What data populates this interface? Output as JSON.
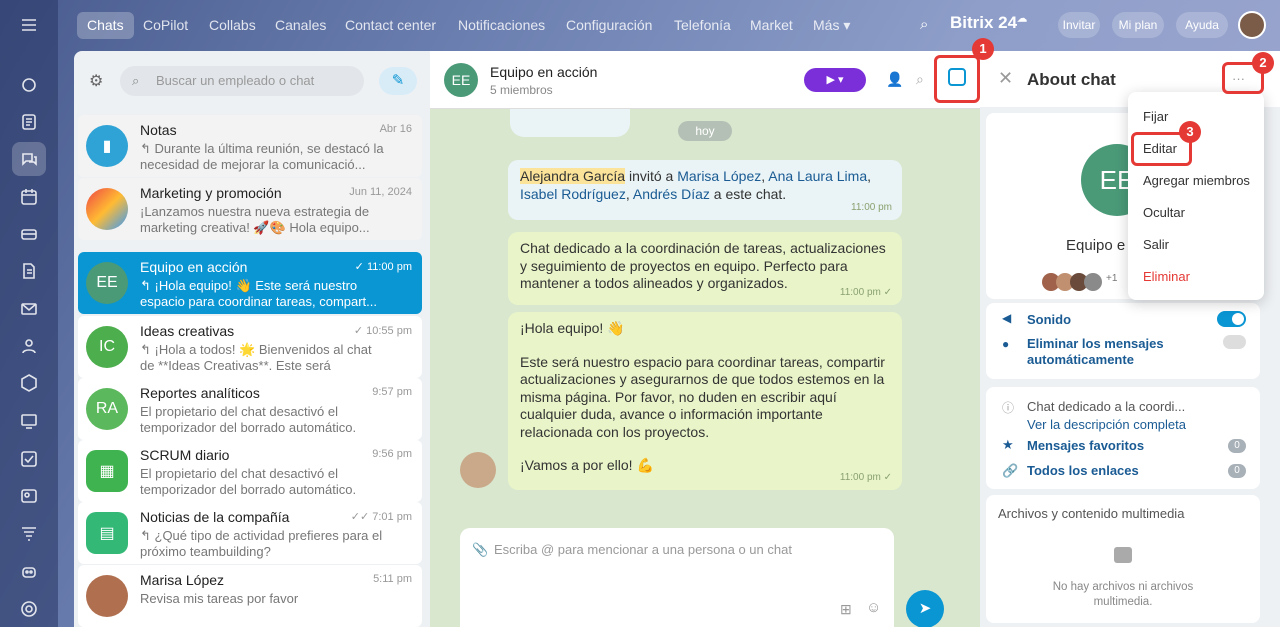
{
  "topbar": {
    "tabs": [
      "Chats",
      "CoPilot",
      "Collabs",
      "Canales",
      "Contact center",
      "Notificaciones",
      "Configuración",
      "Telefonía",
      "Market",
      "Más ▾"
    ],
    "brand": "Bitrix 24",
    "brand_sup": "☁",
    "invite": "Invitar",
    "plan": "Mi plan",
    "help": "Ayuda"
  },
  "left": {
    "search_placeholder": "Buscar un empleado o chat",
    "chats": [
      {
        "name": "Notas",
        "time": "Abr 16",
        "preview": "↰ Durante la última reunión, se destacó la necesidad de mejorar la comunicació...",
        "initials": "",
        "color": "#2fa3d6"
      },
      {
        "name": "Marketing y promoción",
        "time": "Jun 11, 2024",
        "preview": "¡Lanzamos nuestra nueva estrategia de marketing creativa! 🚀🎨 Hola equipo...",
        "initials": "",
        "color": "#e36"
      },
      {
        "name": "Equipo en acción",
        "time": "✓ 11:00 pm",
        "preview": "↰ ¡Hola equipo! 👋 Este será nuestro espacio para coordinar tareas, compart...",
        "initials": "EE",
        "color": "#4a9a78"
      },
      {
        "name": "Ideas creativas",
        "time": "✓ 10:55 pm",
        "preview": "↰ ¡Hola a todos! 🌟 Bienvenidos al chat de **Ideas Creativas**. Este será nuestro...",
        "initials": "IC",
        "color": "#4cae4c"
      },
      {
        "name": "Reportes analíticos",
        "time": "9:57 pm",
        "preview": "El propietario del chat desactivó el temporizador del borrado automático.",
        "initials": "RA",
        "color": "#5cb85c"
      },
      {
        "name": "SCRUM diario",
        "time": "9:56 pm",
        "preview": "El propietario del chat desactivó el temporizador del borrado automático.",
        "initials": "",
        "color": "#3fb34f"
      },
      {
        "name": "Noticias de la compañía",
        "time": "✓✓ 7:01 pm",
        "preview": "↰ ¿Qué tipo de actividad prefieres para el próximo teambuilding?",
        "initials": "",
        "color": "#33b876"
      },
      {
        "name": "Marisa López",
        "time": "5:11 pm",
        "preview": "Revisa mis tareas por favor",
        "initials": "",
        "color": "#b07050"
      }
    ]
  },
  "center": {
    "title": "Equipo en acción",
    "subtitle": "5 miembros",
    "initials": "EE",
    "day": "hoy",
    "sys_name": "Alejandra García",
    "sys_verb": " invitó a ",
    "sys_people": [
      "Marisa López",
      "Ana Laura Lima",
      "Isabel Rodríguez",
      "Andrés Díaz"
    ],
    "sys_tail": " a este chat.",
    "sys_time": "11:00 pm",
    "msg1": "Chat dedicado a la coordinación de tareas, actualizaciones y seguimiento de proyectos en equipo. Perfecto para mantener a todos alineados y organizados.",
    "msg1_time": "11:00 pm ✓",
    "msg2_a": "¡Hola equipo! 👋",
    "msg2_b": "Este será nuestro espacio para coordinar tareas, compartir actualizaciones y asegurarnos de que todos estemos en la misma página. Por favor, no duden en escribir aquí cualquier duda, avance o información importante relacionada con los proyectos.",
    "msg2_c": "¡Vamos a por ello! 💪",
    "msg2_time": "11:00 pm ✓",
    "input_placeholder": "Escriba @ para mencionar a una persona o un chat"
  },
  "right": {
    "title": "About chat",
    "chat_name": "Equipo e",
    "avatar": "EE",
    "members_extra": "+1",
    "sound": "Sonido",
    "auto_delete": "Eliminar los mensajes automáticamente",
    "desc": "Chat dedicado a la coordi...",
    "desc_link": "Ver la descripción completa",
    "favorites": "Mensajes favoritos",
    "links": "Todos los enlaces",
    "zero": "0",
    "files_title": "Archivos y contenido multimedia",
    "files_empty": "No hay archivos ni archivos multimedia."
  },
  "menu": {
    "items": [
      "Fijar",
      "Editar",
      "Agregar miembros",
      "Ocultar",
      "Salir",
      "Eliminar"
    ]
  },
  "badges": [
    "1",
    "2",
    "3"
  ],
  "colors": {
    "accent": "#0a95d3",
    "danger": "#e53935",
    "purple": "#7b2fd9"
  }
}
